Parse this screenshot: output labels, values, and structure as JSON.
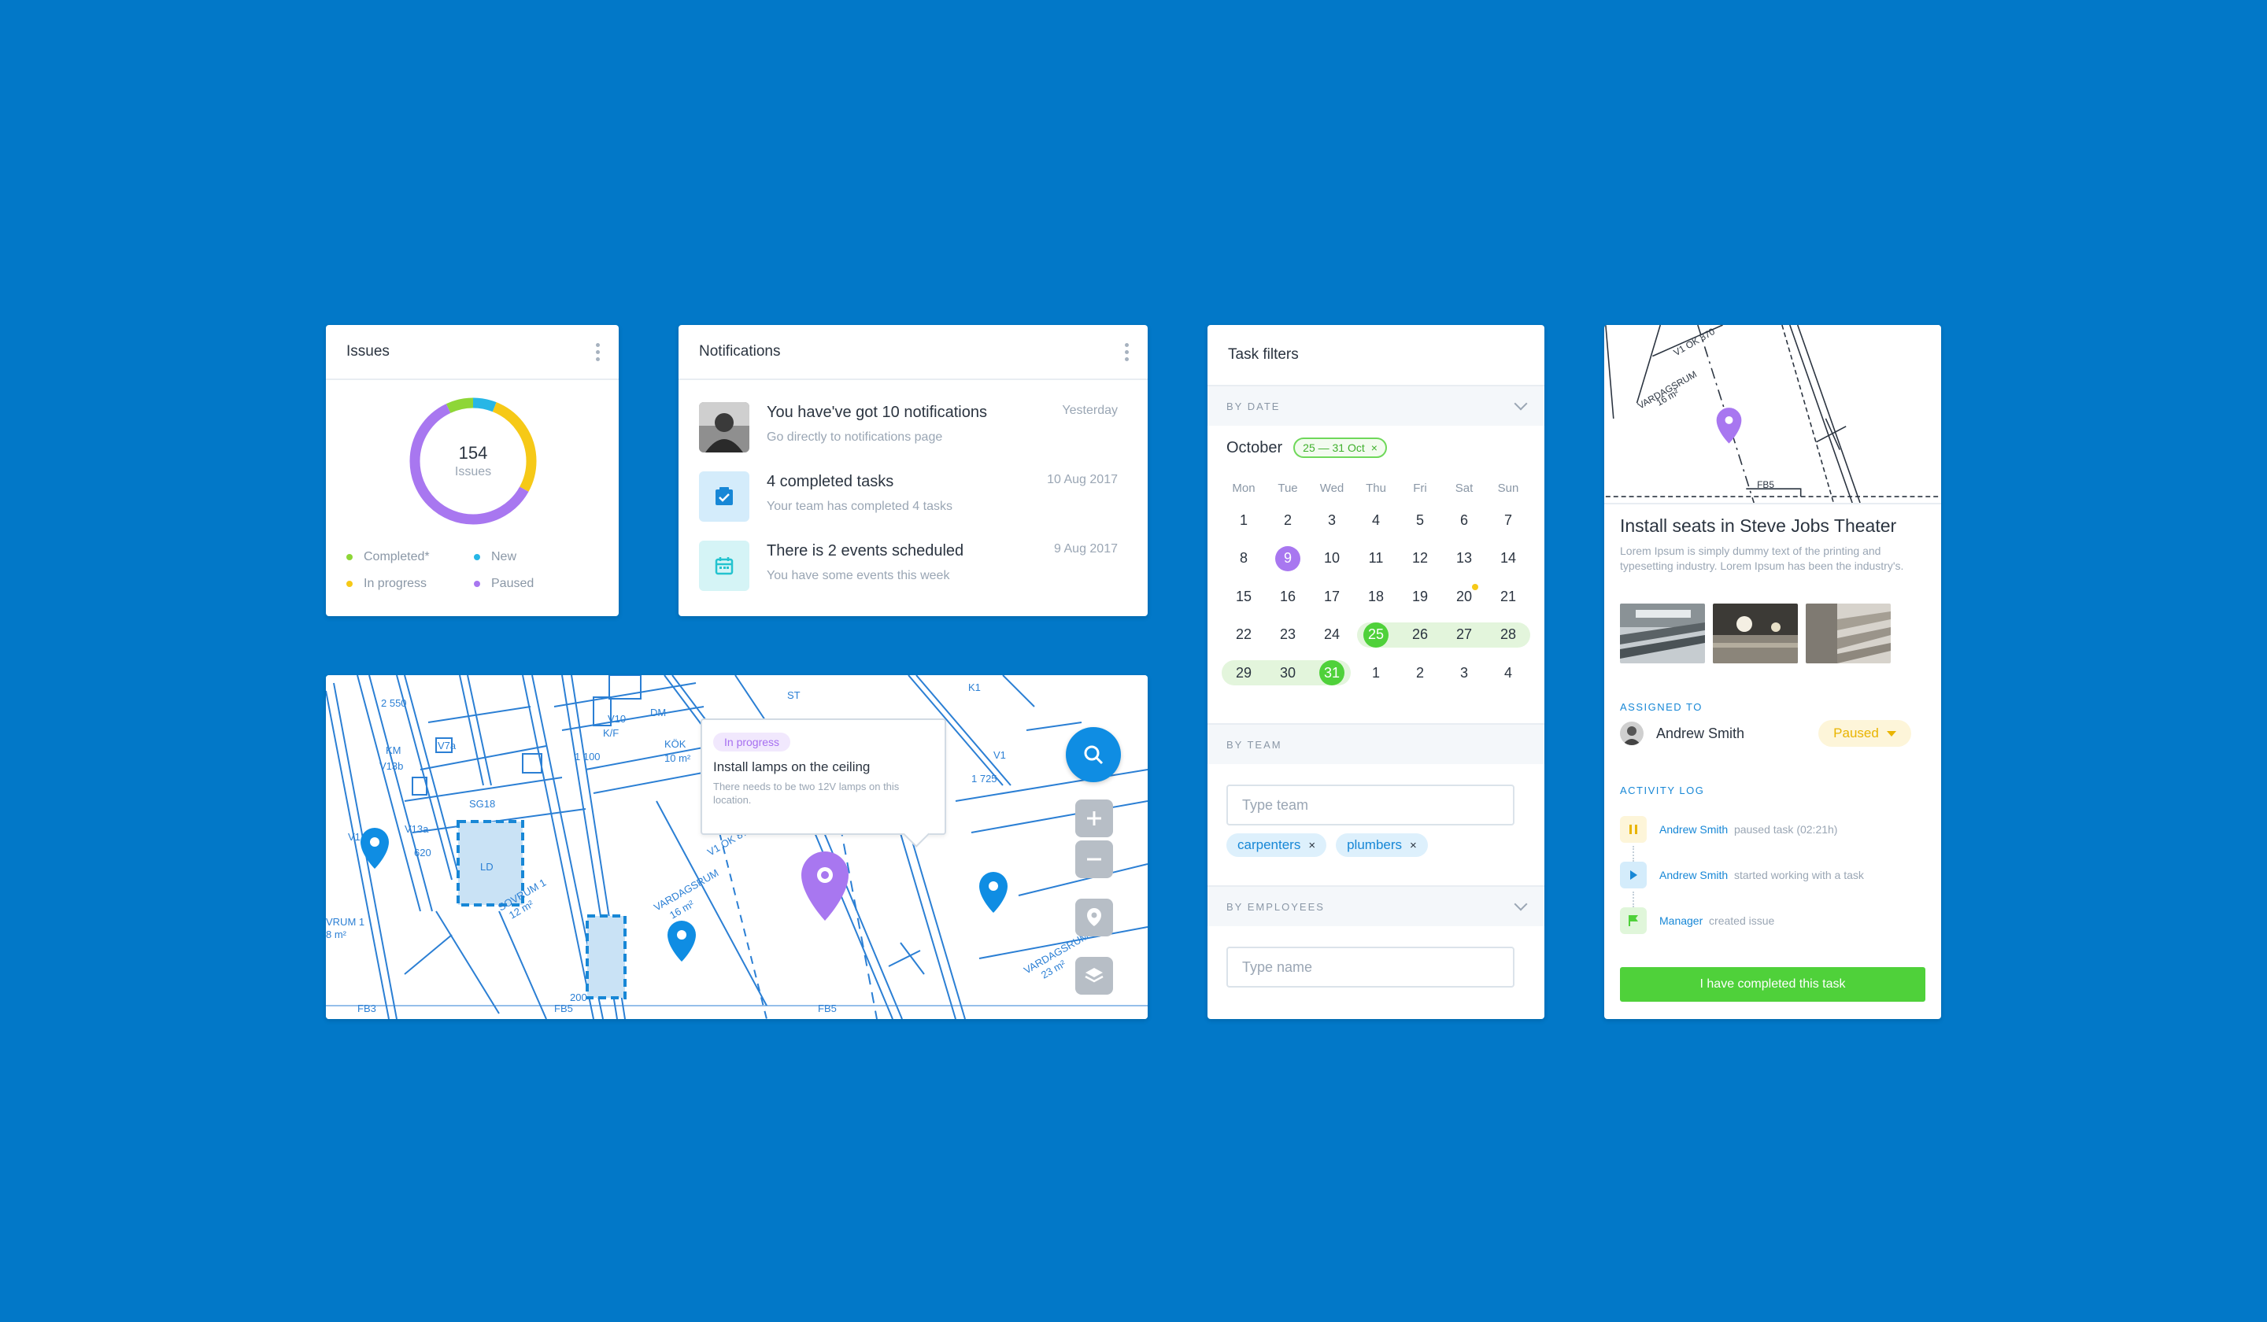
{
  "issues": {
    "title": "Issues",
    "total": "154",
    "total_label": "Issues",
    "legend": [
      {
        "label": "Completed*",
        "color": "#8ed637"
      },
      {
        "label": "New",
        "color": "#27b6e6"
      },
      {
        "label": "In progress",
        "color": "#f6c917"
      },
      {
        "label": "Paused",
        "color": "#a877f0"
      }
    ],
    "segments": [
      {
        "name": "New",
        "fraction": 0.06,
        "color": "#27b6e6"
      },
      {
        "name": "In progress",
        "fraction": 0.27,
        "color": "#f6c917"
      },
      {
        "name": "Paused",
        "fraction": 0.6,
        "color": "#a877f0"
      },
      {
        "name": "Completed*",
        "fraction": 0.07,
        "color": "#8ed637"
      }
    ]
  },
  "notifications": {
    "title": "Notifications",
    "items": [
      {
        "title": "You have've got 10 notifications",
        "subtitle": "Go directly to notifications page",
        "date": "Yesterday",
        "icon": "user-avatar"
      },
      {
        "title": "4 completed tasks",
        "subtitle": "Your team has completed 4 tasks",
        "date": "10 Aug 2017",
        "icon": "check-square-icon"
      },
      {
        "title": "There is 2 events scheduled",
        "subtitle": "You have some events this week",
        "date": "9 Aug 2017",
        "icon": "calendar-icon"
      }
    ]
  },
  "filters": {
    "title": "Task filters",
    "by_date": "BY DATE",
    "month": "October",
    "range": "25 — 31 Oct",
    "weekdays": [
      "Mon",
      "Tue",
      "Wed",
      "Thu",
      "Fri",
      "Sat",
      "Sun"
    ],
    "weeks": [
      [
        "1",
        "2",
        "3",
        "4",
        "5",
        "6",
        "7"
      ],
      [
        "8",
        "9",
        "10",
        "11",
        "12",
        "13",
        "14"
      ],
      [
        "15",
        "16",
        "17",
        "18",
        "19",
        "20",
        "21"
      ],
      [
        "22",
        "23",
        "24",
        "25",
        "26",
        "27",
        "28"
      ],
      [
        "29",
        "30",
        "31",
        "1",
        "2",
        "3",
        "4"
      ]
    ],
    "by_team": "BY TEAM",
    "team_placeholder": "Type team",
    "teams": [
      "carpenters",
      "plumbers"
    ],
    "by_employees": "BY EMPLOYEES",
    "employee_placeholder": "Type name"
  },
  "task": {
    "title": "Install seats in Steve Jobs Theater",
    "description": "Lorem Ipsum is simply dummy text of the printing and typesetting industry. Lorem Ipsum has been the industry's.",
    "assigned_label": "ASSIGNED TO",
    "assignee": "Andrew Smith",
    "status": "Paused",
    "activity_label": "ACTIVITY LOG",
    "log": [
      {
        "name": "Andrew Smith",
        "text": "paused task (02:21h)",
        "icon": "pause-icon"
      },
      {
        "name": "Andrew Smith",
        "text": "started working with a task",
        "icon": "play-icon"
      },
      {
        "name": "Manager",
        "text": "created issue",
        "icon": "flag-icon"
      }
    ],
    "complete_button": "I have completed this task",
    "map_labels": [
      "V1 OK 870",
      "VARDAGSRUM",
      "16 m²",
      "FB5"
    ]
  },
  "map": {
    "tooltip_badge": "In progress",
    "tooltip_title": "Install lamps on the ceiling",
    "tooltip_sub": "There needs to be two 12V lamps on this location.",
    "labels": [
      "V1",
      "LD",
      "SG18",
      "KM",
      "V13b",
      "V13a",
      "V7a",
      "V10",
      "K/F",
      "DM",
      "KÖK",
      "10 m²",
      "VARDAGSRUM",
      "16 m²",
      "V1 OK 870",
      "SOVRUM 1",
      "12 m²",
      "FB3",
      "FB5",
      "VRUM 1",
      "8 m²",
      "1 725",
      "1 100",
      "2 550",
      "620",
      "200",
      "ST",
      "K1",
      "VARDAGSRUM",
      "23 m²"
    ]
  }
}
